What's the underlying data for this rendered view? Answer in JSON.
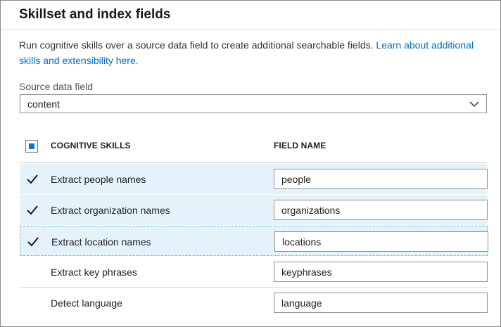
{
  "section": {
    "title": "Skillset and index fields",
    "description": "Run cognitive skills over a source data field to create additional searchable fields.",
    "link_text": "Learn about additional skills and extensibility here."
  },
  "source_field": {
    "label": "Source data field",
    "selected": "content"
  },
  "table": {
    "header_skills": "COGNITIVE SKILLS",
    "header_field": "FIELD NAME",
    "select_all_state": "indeterminate",
    "rows": [
      {
        "skill": "Extract people names",
        "field": "people",
        "checked": true
      },
      {
        "skill": "Extract organization names",
        "field": "organizations",
        "checked": true
      },
      {
        "skill": "Extract location names",
        "field": "locations",
        "checked": true
      },
      {
        "skill": "Extract key phrases",
        "field": "keyphrases",
        "checked": false
      },
      {
        "skill": "Detect language",
        "field": "language",
        "checked": false
      }
    ]
  },
  "colors": {
    "link": "#0a6cbd",
    "accent": "#0a78d4",
    "selected_row": "#e6f2fa"
  }
}
